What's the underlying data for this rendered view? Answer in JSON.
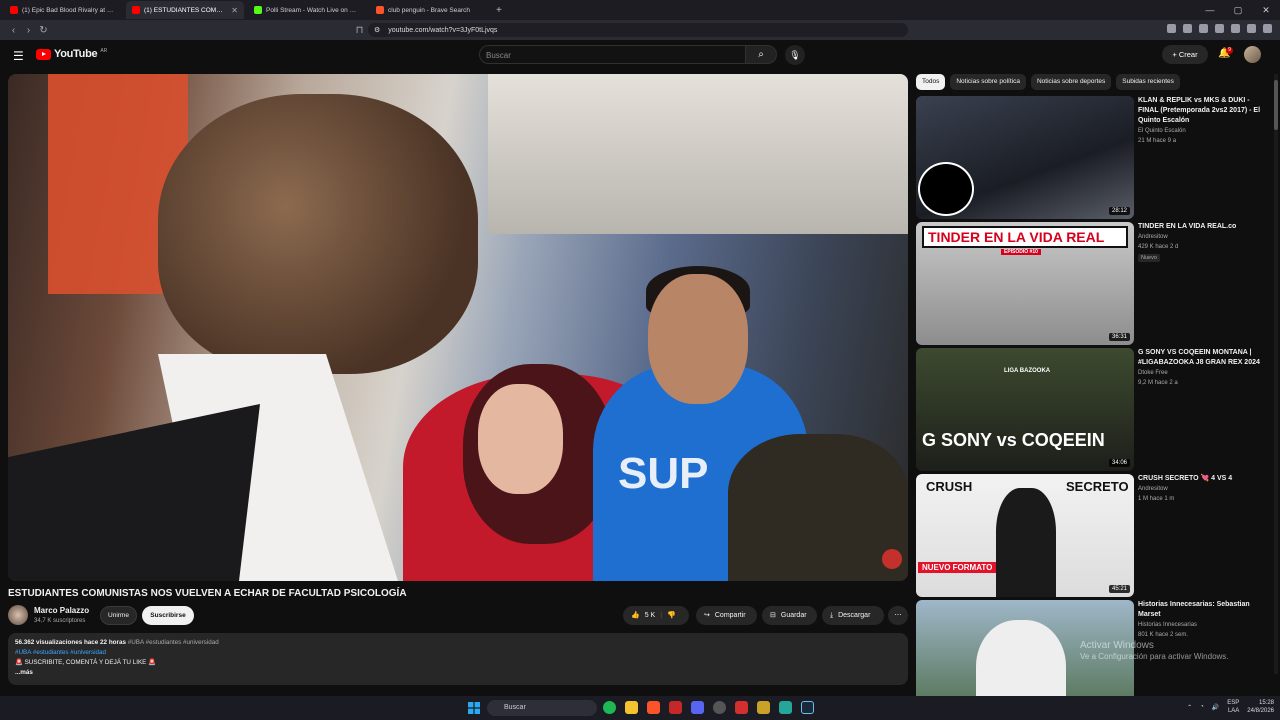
{
  "browser": {
    "tabs": [
      {
        "label": "(1) Epic Bad Blood Rivalry at Power S",
        "color": "#ff0000",
        "active": false
      },
      {
        "label": "(1) ESTUDIANTES COMUNISTAS",
        "color": "#ff0000",
        "active": true
      },
      {
        "label": "Polli Stream - Watch Live on Kick",
        "color": "#53fc18",
        "active": false
      },
      {
        "label": "club penguin - Brave Search",
        "color": "#fb542b",
        "active": false
      }
    ],
    "url": "youtube.com/watch?v=3JyF0tLjvqs"
  },
  "header": {
    "logo_text": "YouTube",
    "country": "AR",
    "search_placeholder": "Buscar",
    "create_label": "Crear",
    "notif_count": "9"
  },
  "video": {
    "overlay_text": "SUP",
    "title": "ESTUDIANTES COMUNISTAS NOS VUELVEN A ECHAR DE FACULTAD PSICOLOGÍA",
    "channel": "Marco Palazzo",
    "subscribers": "34,7 K suscriptores",
    "join_label": "Unirme",
    "subscribe_label": "Suscribirse",
    "likes": "5 K",
    "share_label": "Compartir",
    "save_label": "Guardar",
    "download_label": "Descargar",
    "views_time": "56.362 visualizaciones  hace 22 horas",
    "tags_inline": "#UBA #estudiantes #universidad",
    "tags_line": "#UBA #estudiantes #universidad",
    "desc_line": "🚨 SUSCRIBITE, COMENTÁ Y DEJÁ TU LIKE 🚨",
    "more": "...más"
  },
  "chips": [
    "Todos",
    "Noticias sobre política",
    "Noticias sobre deportes",
    "Subidas recientes"
  ],
  "recommendations": [
    {
      "title": "KLAN & REPLIK vs MKS & DUKI - FINAL (Pretemporada 2vs2 2017) - El Quinto Escalón",
      "channel": "El Quinto Escalón",
      "meta": "21 M  hace 9 a",
      "duration": "28:12",
      "badge": ""
    },
    {
      "title": "TINDER EN LA VIDA REAL.co",
      "channel": "Andresitow",
      "meta": "429 K  hace 2 d",
      "duration": "36:31",
      "badge": "Nuevo",
      "thumb_text": "TINDER EN LA VIDA REAL",
      "thumb_sub": "EPISODIO #10"
    },
    {
      "title": "G SONY VS COQEEIN MONTANA | #LIGABAZOOKA J8 GRAN REX 2024",
      "channel": "Dtoke Free",
      "meta": "9,2 M  hace 2 a",
      "duration": "34:06",
      "badge": "",
      "thumb_text": "G SONY vs COQEEIN",
      "thumb_sub": "LIGA BAZOOKA"
    },
    {
      "title": "CRUSH SECRETO 💘 4 VS 4",
      "channel": "Andresitow",
      "meta": "1 M  hace 1 m",
      "duration": "45:21",
      "badge": "",
      "thumb_text": "CRUSH",
      "thumb_text2": "SECRETO",
      "thumb_sub": "NUEVO FORMATO"
    },
    {
      "title": "Historias Innecesarias: Sebastian Marset",
      "channel": "Historias Innecesarias",
      "meta": "801 K  hace 2 sem.",
      "duration": "",
      "badge": ""
    }
  ],
  "watermark": {
    "line1": "Activar Windows",
    "line2": "Ve a Configuración para activar Windows."
  },
  "taskbar": {
    "search_label": "Buscar",
    "lang": "ESP",
    "lang2": "LAA",
    "time": "15:28",
    "date": "24/8/2026"
  }
}
